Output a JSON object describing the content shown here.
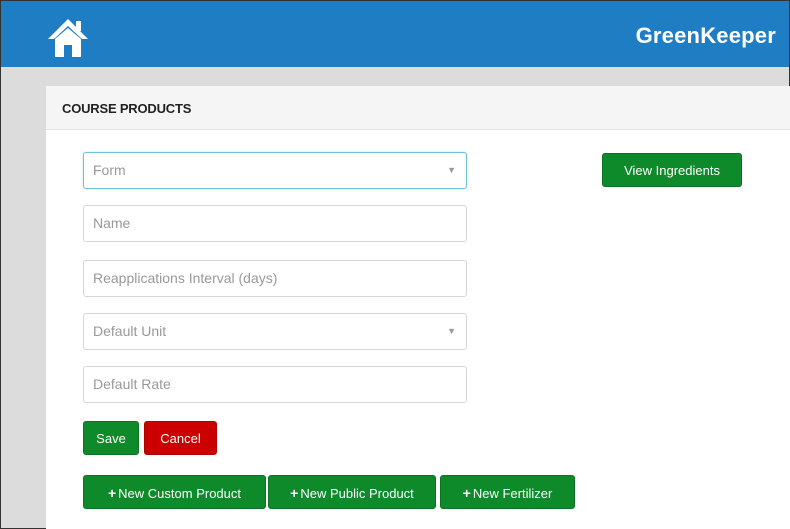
{
  "header": {
    "brand": "GreenKeeper",
    "home_icon": "home-icon",
    "bg_color": "#1f7dc4"
  },
  "panel": {
    "title": "COURSE PRODUCTS"
  },
  "form": {
    "form_select_placeholder": "Form",
    "name_placeholder": "Name",
    "interval_placeholder": "Reapplications Interval (days)",
    "unit_select_placeholder": "Default Unit",
    "rate_placeholder": "Default Rate"
  },
  "buttons": {
    "view_ingredients": "View Ingredients",
    "save": "Save",
    "cancel": "Cancel",
    "new_custom": "New Custom Product",
    "new_public": "New Public Product",
    "new_fertilizer": "New Fertilizer",
    "plus_glyph": "+"
  },
  "colors": {
    "primary_green": "#0f8a2a",
    "danger_red": "#cc0000"
  }
}
